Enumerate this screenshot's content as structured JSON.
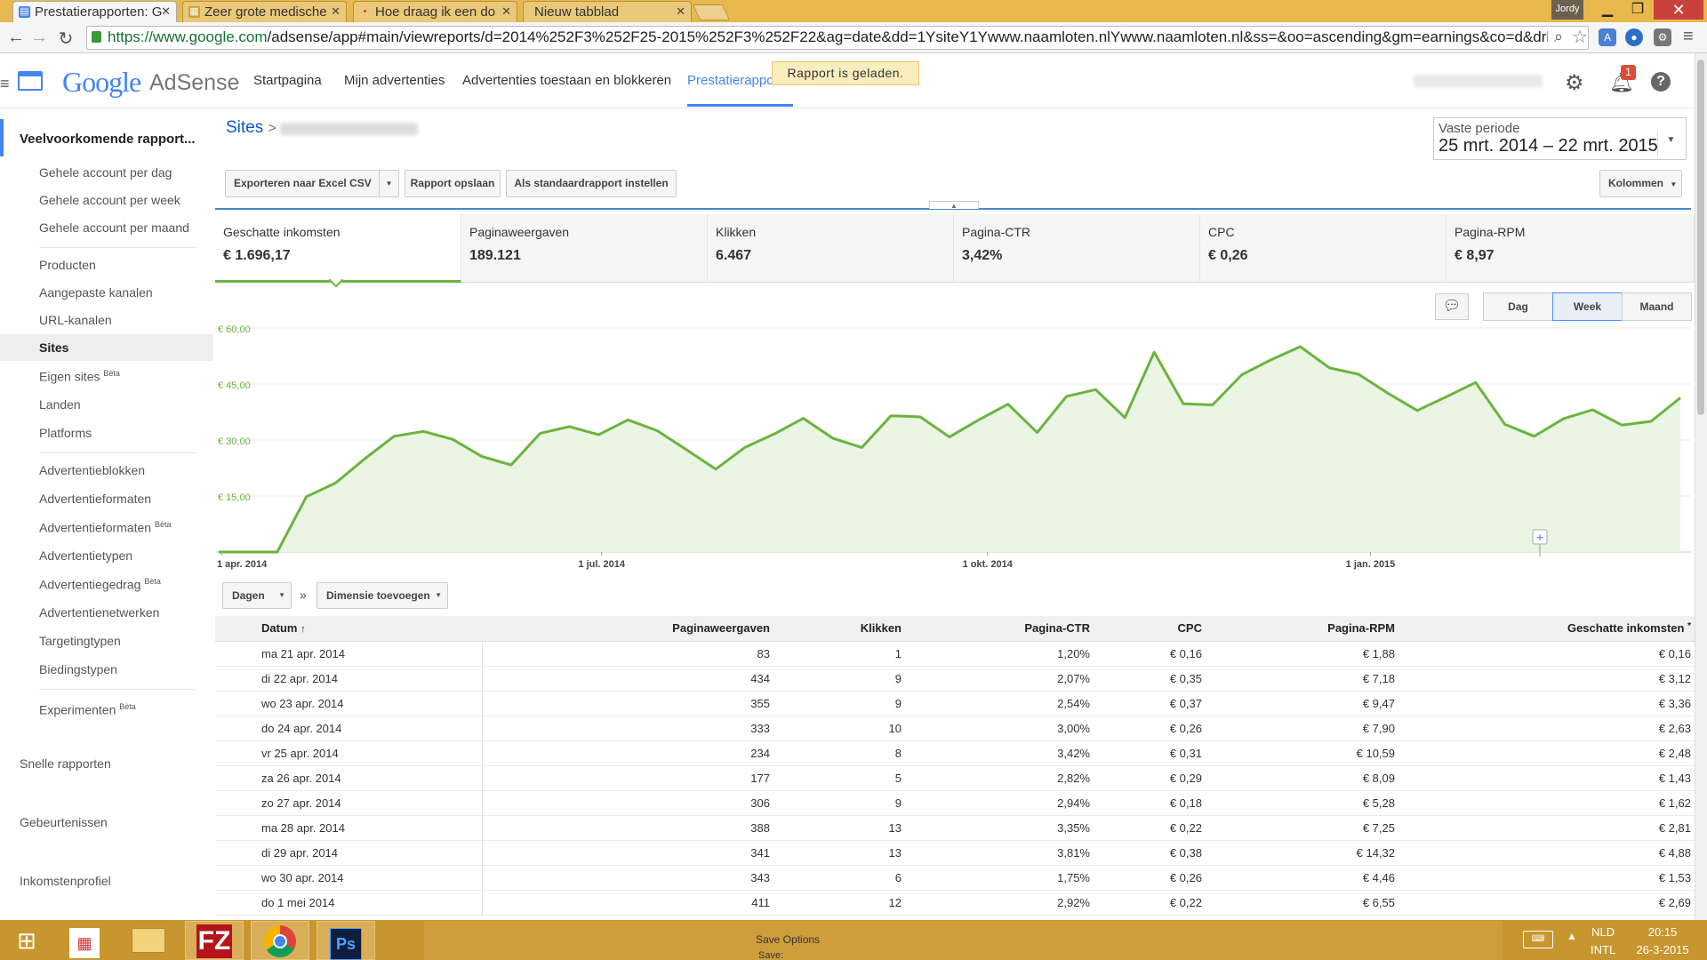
{
  "browser": {
    "tabs": [
      {
        "label": "Prestatierapporten: G",
        "icon": "adsense-icon"
      },
      {
        "label": "Zeer grote medische",
        "icon": "page-icon"
      },
      {
        "label": "Hoe draag ik een do",
        "icon": "page-icon"
      },
      {
        "label": "Nieuw tabblad",
        "icon": "none"
      }
    ],
    "user_badge": "Jordy",
    "url_host": "https://www.google.com",
    "url_path": "/adsense/app#main/viewreports/d=2014%252F3%252F25-2015%252F3%252F22&ag=date&dd=1YsiteY1Ywww.naamloten.nlYwww.naamloten.nl&ss=&oo=ascending&gm=earnings&co=d&drh=false&ct="
  },
  "app": {
    "logo_google": "Google",
    "logo_product": "AdSense",
    "nav": [
      "Startpagina",
      "Mijn advertenties",
      "Advertenties toestaan en blokkeren",
      "Prestatierapporten"
    ],
    "toast": "Rapport is geladen.",
    "notification_count": "1",
    "help_glyph": "?"
  },
  "sidebar": {
    "heading": "Veelvoorkomende rapport...",
    "group1": [
      "Gehele account per dag",
      "Gehele account per week",
      "Gehele account per maand"
    ],
    "group2": [
      "Producten",
      "Aangepaste kanalen",
      "URL-kanalen",
      "Sites",
      "Eigen sites",
      "Landen",
      "Platforms"
    ],
    "group3": [
      "Advertentieblokken",
      "Advertentieformaten",
      "Advertentieformaten",
      "Advertentietypen",
      "Advertentiegedrag",
      "Advertentienetwerken",
      "Targetingtypen",
      "Biedingstypen"
    ],
    "experiments": "Experimenten",
    "beta": "Bèta",
    "sections": [
      "Snelle rapporten",
      "Gebeurtenissen",
      "Inkomstenprofiel"
    ]
  },
  "report": {
    "breadcrumb": "Sites",
    "breadcrumb_sep": ">",
    "period_label": "Vaste periode",
    "period_value": "25 mrt. 2014 – 22 mrt. 2015",
    "buttons": {
      "export": "Exporteren naar Excel CSV",
      "save": "Rapport opslaan",
      "default": "Als standaardrapport instellen",
      "columns": "Kolommen"
    },
    "cards": [
      {
        "label": "Geschatte inkomsten",
        "value": "€ 1.696,17"
      },
      {
        "label": "Paginaweergaven",
        "value": "189.121"
      },
      {
        "label": "Klikken",
        "value": "6.467"
      },
      {
        "label": "Pagina-CTR",
        "value": "3,42%"
      },
      {
        "label": "CPC",
        "value": "€ 0,26"
      },
      {
        "label": "Pagina-RPM",
        "value": "€ 8,97"
      }
    ],
    "granularity": [
      "Dag",
      "Week",
      "Maand"
    ],
    "granularity_selected": "Week",
    "table_controls": {
      "group_by": "Dagen",
      "add_dimension": "Dimensie toevoegen",
      "separator": "»"
    },
    "columns": [
      "Datum",
      "Paginaweergaven",
      "Klikken",
      "Pagina-CTR",
      "CPC",
      "Pagina-RPM",
      "Geschatte inkomsten"
    ],
    "sort_marker": "↑",
    "estimate_marker": "*",
    "rows": [
      [
        "ma 21 apr. 2014",
        "83",
        "1",
        "1,20%",
        "€ 0,16",
        "€ 1,88",
        "€ 0,16"
      ],
      [
        "di 22 apr. 2014",
        "434",
        "9",
        "2,07%",
        "€ 0,35",
        "€ 7,18",
        "€ 3,12"
      ],
      [
        "wo 23 apr. 2014",
        "355",
        "9",
        "2,54%",
        "€ 0,37",
        "€ 9,47",
        "€ 3,36"
      ],
      [
        "do 24 apr. 2014",
        "333",
        "10",
        "3,00%",
        "€ 0,26",
        "€ 7,90",
        "€ 2,63"
      ],
      [
        "vr 25 apr. 2014",
        "234",
        "8",
        "3,42%",
        "€ 0,31",
        "€ 10,59",
        "€ 2,48"
      ],
      [
        "za 26 apr. 2014",
        "177",
        "5",
        "2,82%",
        "€ 0,29",
        "€ 8,09",
        "€ 1,43"
      ],
      [
        "zo 27 apr. 2014",
        "306",
        "9",
        "2,94%",
        "€ 0,18",
        "€ 5,28",
        "€ 1,62"
      ],
      [
        "ma 28 apr. 2014",
        "388",
        "13",
        "3,35%",
        "€ 0,22",
        "€ 7,25",
        "€ 2,81"
      ],
      [
        "di 29 apr. 2014",
        "341",
        "13",
        "3,81%",
        "€ 0,38",
        "€ 14,32",
        "€ 4,88"
      ],
      [
        "wo 30 apr. 2014",
        "343",
        "6",
        "1,75%",
        "€ 0,26",
        "€ 4,46",
        "€ 1,53"
      ],
      [
        "do 1 mei 2014",
        "411",
        "12",
        "2,92%",
        "€ 0,22",
        "€ 6,55",
        "€ 2,69"
      ]
    ]
  },
  "chart_data": {
    "type": "area",
    "y_ticks": [
      "€ 60,00",
      "€ 45,00",
      "€ 30,00",
      "€ 15,00"
    ],
    "y_tick_values": [
      60,
      45,
      30,
      15
    ],
    "ylim": [
      0,
      60
    ],
    "x_tick_labels": [
      "1 apr. 2014",
      "1 jul. 2014",
      "1 okt. 2014",
      "1 jan. 2015"
    ],
    "x_tick_weeks": [
      0.1,
      13.1,
      26.3,
      39.4
    ],
    "x_start": "25 mrt. 2014",
    "x_end": "22 mrt. 2015",
    "interval": "week",
    "grid": true,
    "color": "#6cb33f",
    "fill": "#eaf5e3",
    "series": [
      {
        "values": [
          0,
          0,
          0,
          14.8,
          18.5,
          25,
          31,
          32.3,
          30.2,
          25.6,
          23.3,
          31.8,
          33.6,
          31.4,
          35.4,
          32.5,
          27.4,
          22.2,
          28,
          31.6,
          35.8,
          30.5,
          28,
          36.5,
          36.2,
          30.8,
          35.4,
          39.6,
          32,
          41.7,
          43.5,
          36,
          53.5,
          39.7,
          39.4,
          47.5,
          51.5,
          55,
          49.3,
          47.6,
          42.5,
          37.9,
          41.6,
          45.4,
          34.2,
          31,
          35.7,
          38.1,
          34,
          35,
          41.3
        ]
      }
    ]
  },
  "taskbar": {
    "save_options": "Save Options",
    "save_label": "Save:",
    "lang": [
      "NLD",
      "INTL"
    ],
    "time": "20:15",
    "date": "26-3-2015"
  }
}
